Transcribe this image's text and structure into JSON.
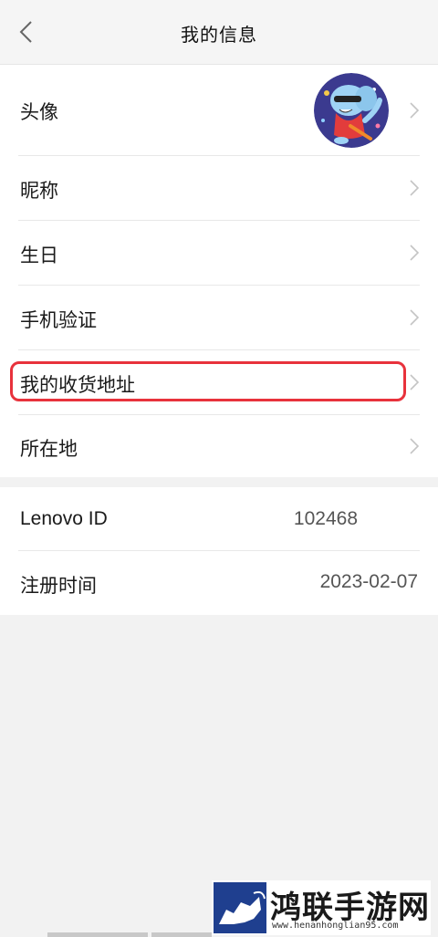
{
  "header": {
    "title": "我的信息"
  },
  "profile": {
    "avatar_label": "头像",
    "nickname_label": "昵称",
    "birthday_label": "生日",
    "phone_label": "手机验证",
    "address_label": "我的收货地址",
    "location_label": "所在地"
  },
  "account": {
    "id_label": "Lenovo ID",
    "id_value": "102468",
    "register_label": "注册时间",
    "register_value": "2023-02-07"
  },
  "watermark": {
    "brand": "鸿联手游网",
    "url": "www.henanhonglian95.com"
  },
  "colors": {
    "highlight": "#e8323c",
    "avatar_bg": "#3b3a8f"
  }
}
